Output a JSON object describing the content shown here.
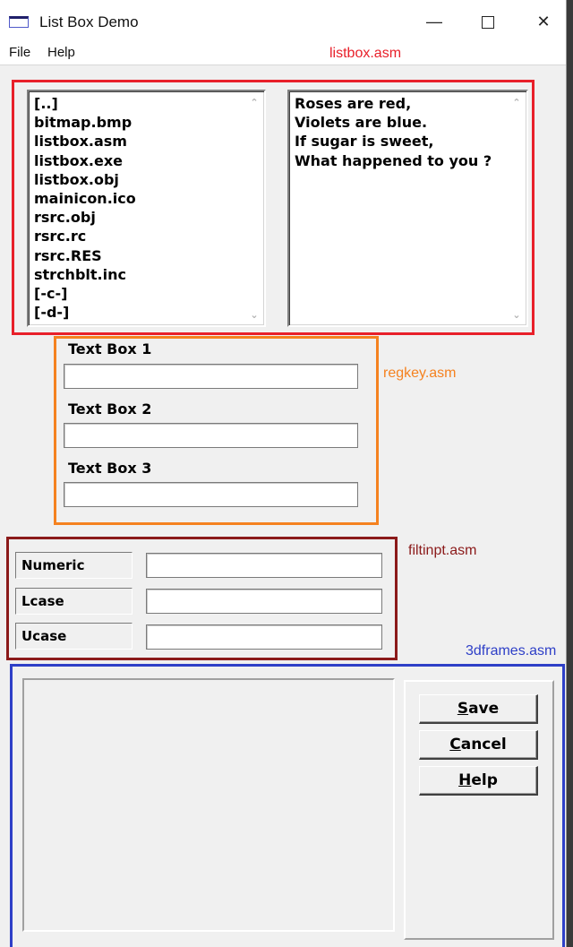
{
  "window": {
    "title": "List Box Demo"
  },
  "menu": [
    {
      "label": "File"
    },
    {
      "label": "Help"
    }
  ],
  "annotations": {
    "listbox": {
      "label": "listbox.asm",
      "color": "#e8202a"
    },
    "regkey": {
      "label": "regkey.asm",
      "color": "#f58220"
    },
    "filtinpt": {
      "label": "filtinpt.asm",
      "color": "#8b1a1a"
    },
    "frames3d": {
      "label": "3dframes.asm",
      "color": "#2e3fc7"
    }
  },
  "file_list": {
    "items": [
      "[..]",
      "bitmap.bmp",
      "listbox.asm",
      "listbox.exe",
      "listbox.obj",
      "mainicon.ico",
      "rsrc.obj",
      "rsrc.rc",
      "rsrc.RES",
      "strchblt.inc",
      "[-c-]",
      "[-d-]"
    ]
  },
  "poem_list": {
    "items": [
      "Roses are red,",
      "Violets are blue.",
      "If sugar is sweet,",
      "What happened to you ?"
    ]
  },
  "text_boxes": [
    {
      "label": "Text Box 1",
      "value": ""
    },
    {
      "label": "Text Box 2",
      "value": ""
    },
    {
      "label": "Text Box 3",
      "value": ""
    }
  ],
  "filters": [
    {
      "label": "Numeric",
      "value": ""
    },
    {
      "label": "Lcase",
      "value": ""
    },
    {
      "label": "Ucase",
      "value": ""
    }
  ],
  "buttons": {
    "save": {
      "mnemonic": "S",
      "rest": "ave"
    },
    "cancel": {
      "mnemonic": "C",
      "rest": "ancel"
    },
    "help": {
      "mnemonic": "H",
      "rest": "elp"
    }
  }
}
